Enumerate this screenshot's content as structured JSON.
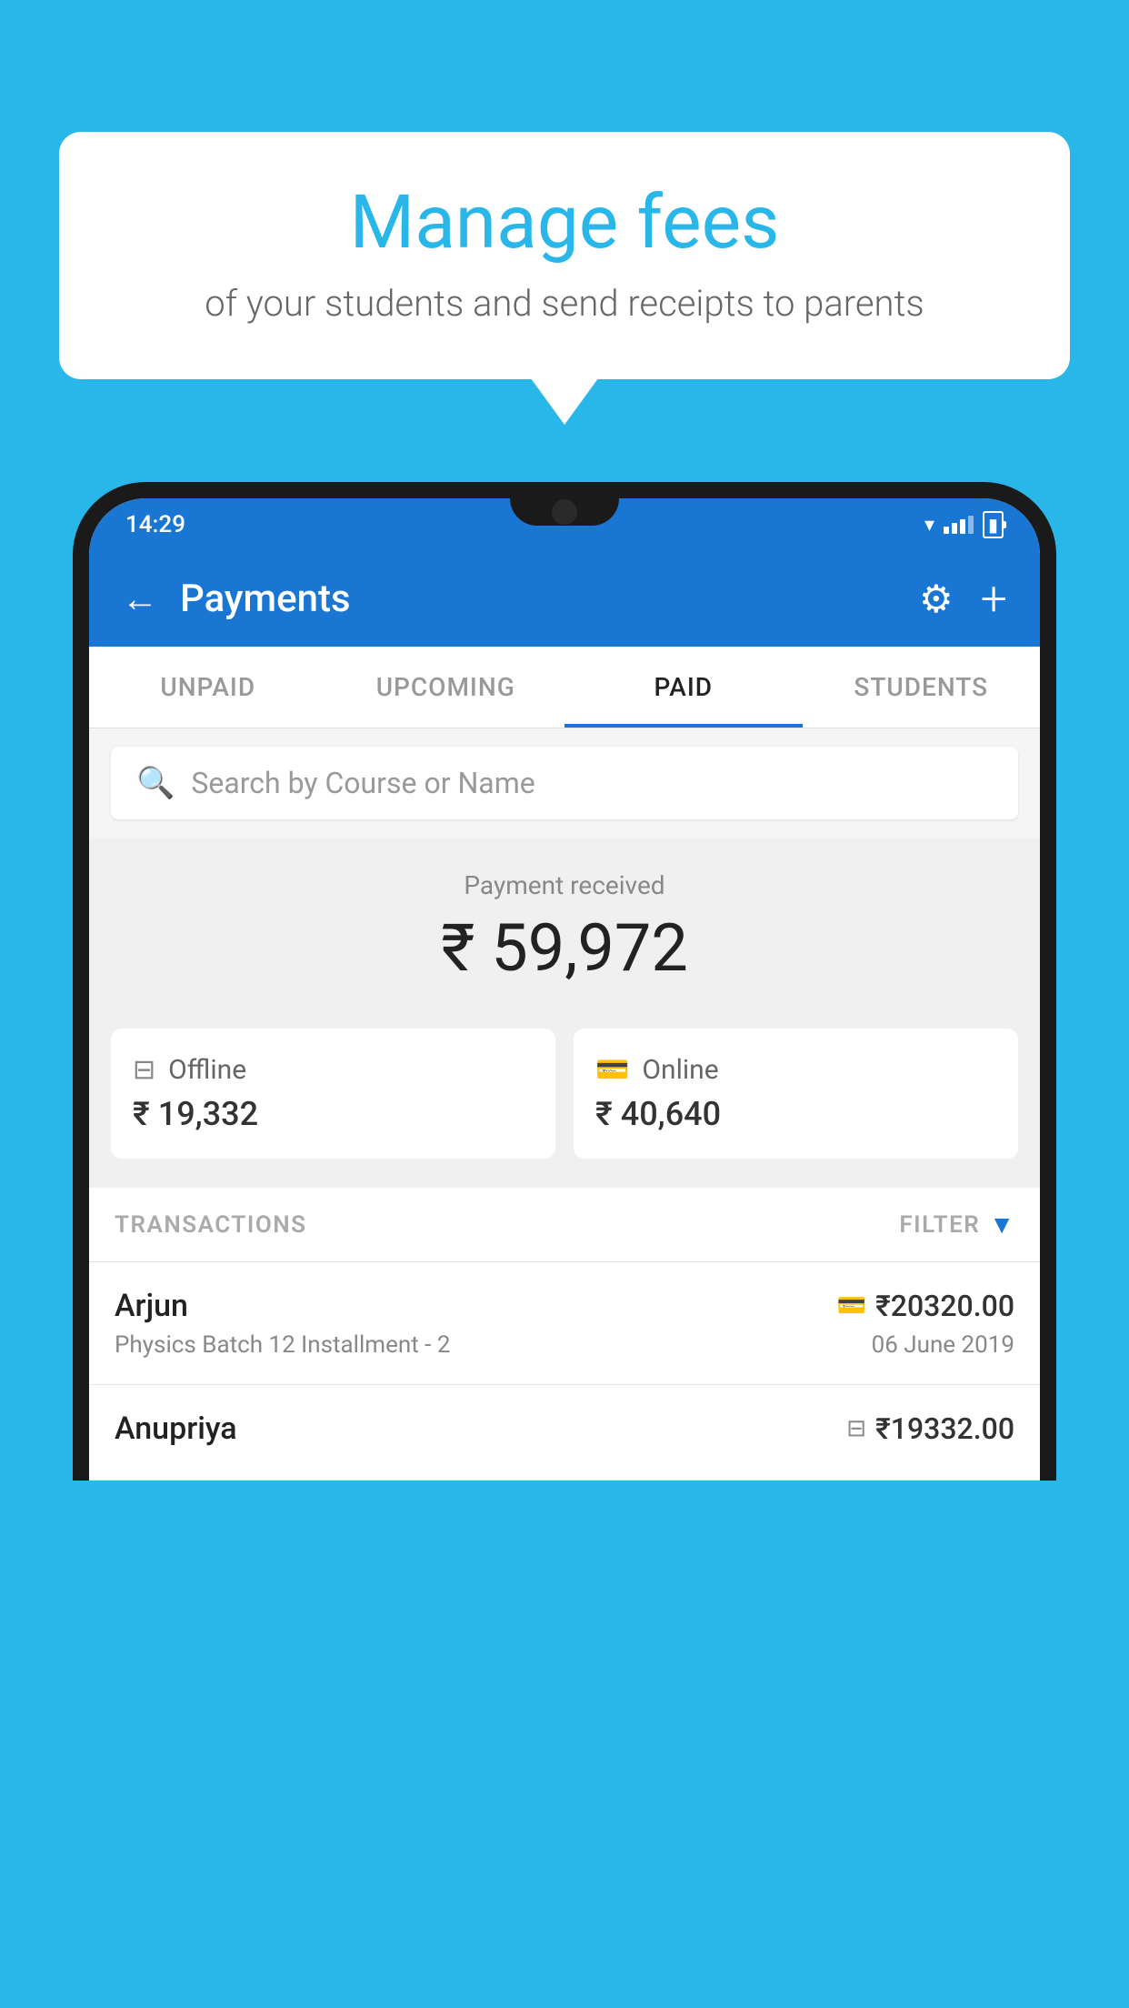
{
  "background_color": "#29b6e8",
  "bubble": {
    "title": "Manage fees",
    "subtitle": "of your students and send receipts to parents"
  },
  "status_bar": {
    "time": "14:29"
  },
  "header": {
    "title": "Payments",
    "back_label": "←",
    "plus_label": "+"
  },
  "tabs": [
    {
      "label": "UNPAID",
      "active": false
    },
    {
      "label": "UPCOMING",
      "active": false
    },
    {
      "label": "PAID",
      "active": true
    },
    {
      "label": "STUDENTS",
      "active": false
    }
  ],
  "search": {
    "placeholder": "Search by Course or Name"
  },
  "payment": {
    "label": "Payment received",
    "amount": "₹ 59,972",
    "offline": {
      "label": "Offline",
      "amount": "₹ 19,332"
    },
    "online": {
      "label": "Online",
      "amount": "₹ 40,640"
    }
  },
  "transactions": {
    "header_label": "TRANSACTIONS",
    "filter_label": "FILTER",
    "items": [
      {
        "name": "Arjun",
        "course": "Physics Batch 12 Installment - 2",
        "amount": "₹20320.00",
        "date": "06 June 2019",
        "icon_type": "card"
      },
      {
        "name": "Anupriya",
        "course": "",
        "amount": "₹19332.00",
        "date": "",
        "icon_type": "offline"
      }
    ]
  }
}
